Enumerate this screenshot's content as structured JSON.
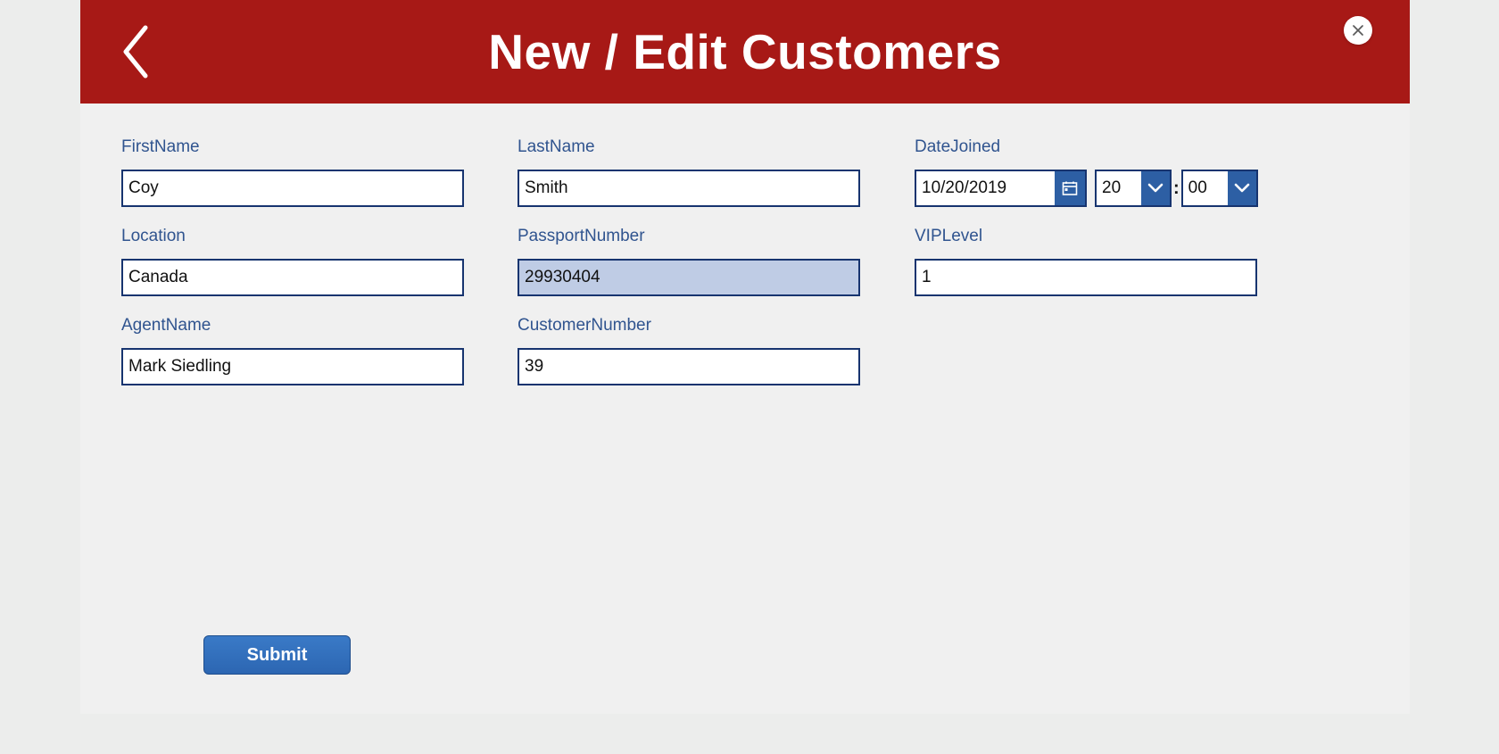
{
  "header": {
    "title": "New / Edit Customers"
  },
  "form": {
    "firstName": {
      "label": "FirstName",
      "value": "Coy"
    },
    "lastName": {
      "label": "LastName",
      "value": "Smith"
    },
    "dateJoined": {
      "label": "DateJoined",
      "date": "10/20/2019",
      "hour": "20",
      "minute": "00"
    },
    "location": {
      "label": "Location",
      "value": "Canada"
    },
    "passportNumber": {
      "label": "PassportNumber",
      "value": "29930404"
    },
    "vipLevel": {
      "label": "VIPLevel",
      "value": "1"
    },
    "agentName": {
      "label": "AgentName",
      "value": "Mark Siedling"
    },
    "customerNumber": {
      "label": "CustomerNumber",
      "value": "39"
    }
  },
  "actions": {
    "submit": "Submit"
  },
  "time": {
    "colon": ":"
  }
}
